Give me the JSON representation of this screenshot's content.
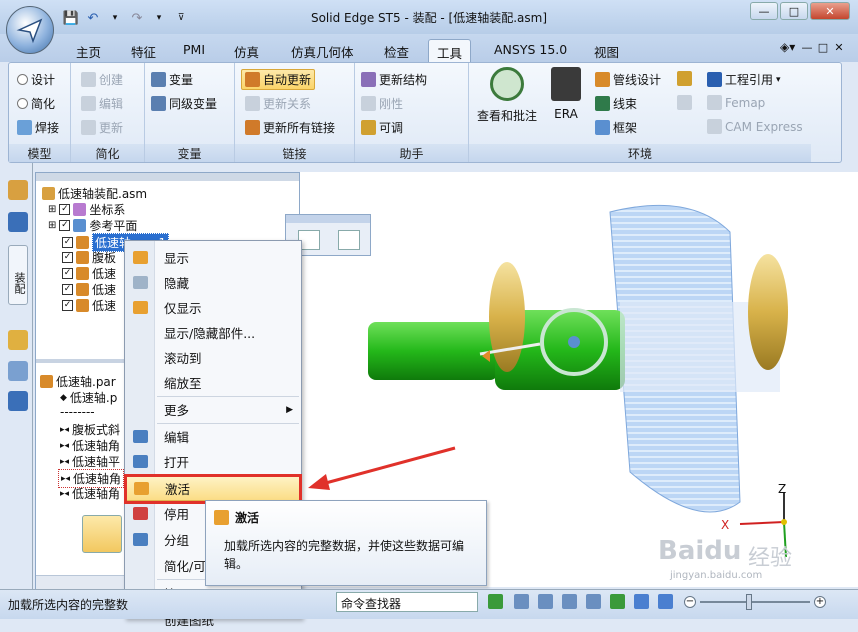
{
  "window": {
    "title": "Solid Edge ST5 - 装配 - [低速轴装配.asm]",
    "controls": [
      "—",
      "□",
      "✕"
    ],
    "doc_controls": [
      "—",
      "□",
      "✕"
    ]
  },
  "tabs": [
    "主页",
    "特征",
    "PMI",
    "仿真",
    "仿真几何体",
    "检查",
    "工具",
    "ANSYS 15.0",
    "视图"
  ],
  "active_tab": "工具",
  "ribbon": {
    "model": {
      "label": "模型",
      "items": [
        "设计",
        "简化",
        "焊接"
      ]
    },
    "simplify": {
      "label": "简化",
      "items": [
        "创建",
        "编辑",
        "更新"
      ]
    },
    "variables": {
      "label": "变量",
      "items": [
        "变量",
        "同级变量"
      ]
    },
    "links": {
      "label": "链接",
      "items": [
        "自动更新",
        "更新关系",
        "更新所有链接"
      ]
    },
    "assistant": {
      "label": "助手",
      "items": [
        "更新结构",
        "刚性",
        "可调"
      ]
    },
    "environment": {
      "label": "环境",
      "review": "查看和批注",
      "era": "ERA",
      "items": [
        "管线设计",
        "线束",
        "框架"
      ],
      "right": [
        "工程引用",
        "Femap",
        "CAM Express"
      ]
    }
  },
  "tree": {
    "root": "低速轴装配.asm",
    "items": [
      "坐标系",
      "参考平面",
      "低速轴.par:1",
      "腹板",
      "低速",
      "低速",
      "低速"
    ],
    "lower_root": "低速轴.par",
    "lower_items": [
      "低速轴.p",
      "--------",
      "腹板式斜",
      "低速轴角",
      "低速轴平",
      "低速轴角",
      "低速轴角"
    ]
  },
  "left_tab_label": "装配",
  "context_menu": [
    {
      "label": "显示"
    },
    {
      "label": "隐藏"
    },
    {
      "label": "仅显示"
    },
    {
      "label": "显示/隐藏部件..."
    },
    {
      "label": "滚动到"
    },
    {
      "label": "缩放至"
    },
    {
      "label": "更多"
    },
    {
      "label": "编辑"
    },
    {
      "label": "打开"
    },
    {
      "label": "激活"
    },
    {
      "label": "停用"
    },
    {
      "label": "分组"
    },
    {
      "label": "简化/可"
    },
    {
      "label": "管理"
    },
    {
      "label": "创建图纸"
    }
  ],
  "tooltip": {
    "title": "激活",
    "body": "加载所选内容的完整数据，并使这些数据可编辑。"
  },
  "status": {
    "text": "加载所选内容的完整数",
    "command_finder": "命令查找器"
  },
  "triad": {
    "x": "X",
    "z": "Z"
  },
  "watermark": {
    "brand": "Baidu",
    "cn": "经验",
    "url": "jingyan.baidu.com"
  },
  "colors": {
    "accent": "#e0312a",
    "highlight": "#fbd46a",
    "part_green": "#2fbf1f",
    "part_gold": "#d8b24a",
    "part_blue": "#9cc3f0"
  }
}
